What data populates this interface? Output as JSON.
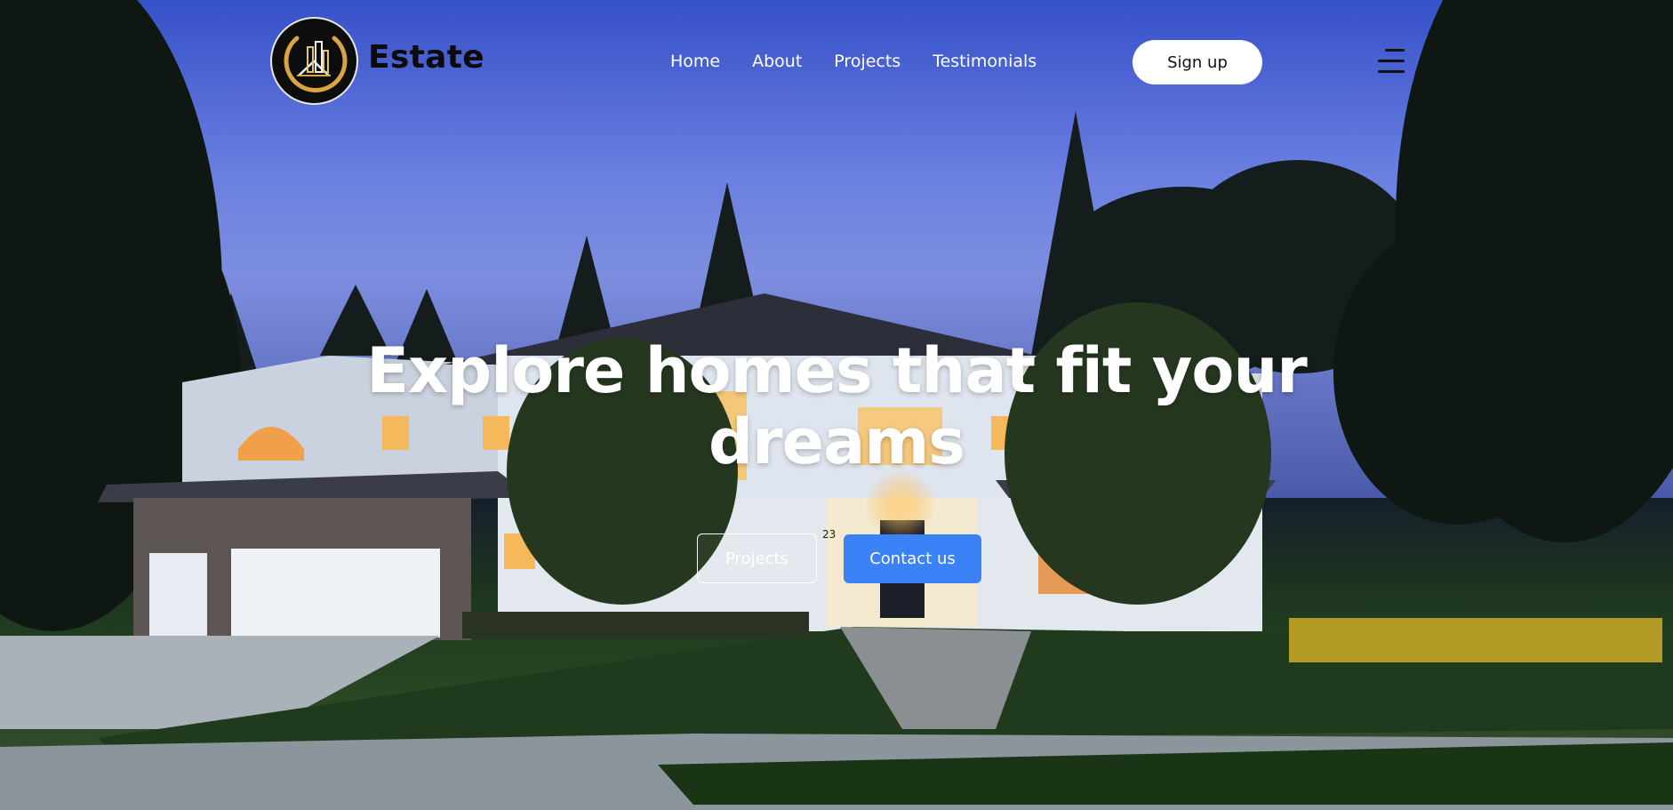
{
  "nav": {
    "brand": "Estate",
    "links": [
      "Home",
      "About",
      "Projects",
      "Testimonials"
    ],
    "signup_label": "Sign up"
  },
  "hero": {
    "headline_line1": "Explore homes that fit your",
    "headline_line2": "dreams",
    "projects_label": "Projects",
    "contact_label": "Contact us",
    "house_number": "23"
  },
  "colors": {
    "accent": "#3b82f6",
    "logo_gold": "#d9a441",
    "sky": "#5876e0"
  },
  "icons": {
    "logo": "house-building-logo-icon",
    "menu": "hamburger-menu-icon"
  }
}
